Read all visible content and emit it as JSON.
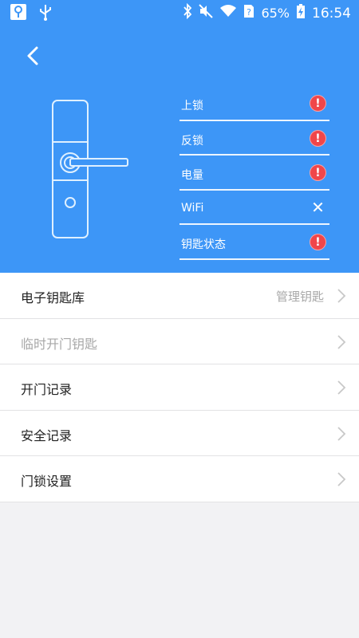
{
  "statusbar": {
    "battery": "65%",
    "time": "16:54"
  },
  "lock_status": [
    {
      "label": "上锁",
      "indicator": "alert"
    },
    {
      "label": "反锁",
      "indicator": "alert"
    },
    {
      "label": "电量",
      "indicator": "alert"
    },
    {
      "label": "WiFi",
      "indicator": "close"
    },
    {
      "label": "钥匙状态",
      "indicator": "alert"
    }
  ],
  "menu": {
    "items": [
      {
        "label": "电子钥匙库",
        "right": "管理钥匙",
        "enabled": true
      },
      {
        "label": "临时开门钥匙",
        "right": "",
        "enabled": false
      },
      {
        "label": "开门记录",
        "right": "",
        "enabled": true
      },
      {
        "label": "安全记录",
        "right": "",
        "enabled": true
      },
      {
        "label": "门锁设置",
        "right": "",
        "enabled": true
      }
    ]
  },
  "colors": {
    "accent": "#3d96f7",
    "alert": "#f0464a"
  }
}
